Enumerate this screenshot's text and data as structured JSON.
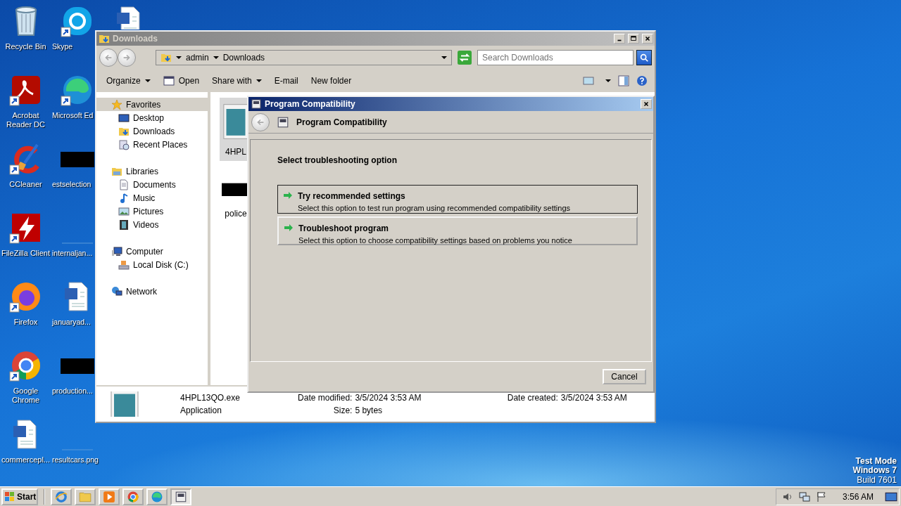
{
  "desktop": {
    "icons": [
      {
        "label": "Recycle Bin",
        "kind": "trash",
        "shortcut": false
      },
      {
        "label": "Acrobat Reader DC",
        "kind": "pdf",
        "shortcut": true
      },
      {
        "label": "CCleaner",
        "kind": "brush",
        "shortcut": true
      },
      {
        "label": "FileZilla Client",
        "kind": "bolt",
        "shortcut": true
      },
      {
        "label": "Firefox",
        "kind": "firefox",
        "shortcut": true
      },
      {
        "label": "Google Chrome",
        "kind": "chrome",
        "shortcut": true
      },
      {
        "label": "commercepl...",
        "kind": "word",
        "shortcut": false
      },
      {
        "label": "Skype",
        "kind": "skype",
        "shortcut": true
      },
      {
        "label": "Microsoft Ed",
        "kind": "edge",
        "shortcut": true
      },
      {
        "label": "estselection",
        "kind": "black",
        "shortcut": false
      },
      {
        "label": "internaljan...",
        "kind": "blank",
        "shortcut": false
      },
      {
        "label": "januaryad...",
        "kind": "word",
        "shortcut": false
      },
      {
        "label": "production...",
        "kind": "black",
        "shortcut": false
      },
      {
        "label": "resultcars.png",
        "kind": "blank",
        "shortcut": false
      },
      {
        "kind": "word",
        "shortcut": false
      }
    ],
    "system_notice": [
      {
        "text": "Test Mode",
        "bold": true
      },
      {
        "text": "Windows 7",
        "bold": true
      },
      {
        "text": "Build 7601",
        "bold": false
      }
    ]
  },
  "explorer": {
    "title": "Downloads",
    "breadcrumb": [
      "admin",
      "Downloads"
    ],
    "search": {
      "placeholder": "Search Downloads"
    },
    "toolbar": [
      {
        "label": "Organize",
        "menu": true
      },
      {
        "label": "Open",
        "kind": "open",
        "menu": false
      },
      {
        "label": "Share with",
        "menu": true
      },
      {
        "label": "E-mail",
        "menu": false
      },
      {
        "label": "New folder",
        "menu": false
      }
    ],
    "toolbar_right": [
      {
        "kind": "views",
        "menu": true
      },
      {
        "kind": "pane",
        "menu": false
      },
      {
        "kind": "help",
        "menu": false
      }
    ],
    "nav": [
      {
        "label": "Favorites",
        "kind": "star",
        "selected": true,
        "children": [
          {
            "label": "Desktop",
            "kind": "desktop",
            "selected": false
          },
          {
            "label": "Downloads",
            "kind": "dlfolder",
            "selected": false
          },
          {
            "label": "Recent Places",
            "kind": "recent",
            "selected": false
          }
        ]
      },
      {
        "label": "Libraries",
        "kind": "libraries",
        "selected": false,
        "children": [
          {
            "label": "Documents",
            "kind": "document",
            "selected": false
          },
          {
            "label": "Music",
            "kind": "music",
            "selected": false
          },
          {
            "label": "Pictures",
            "kind": "pictures",
            "selected": false
          },
          {
            "label": "Videos",
            "kind": "videos",
            "selected": false
          }
        ]
      },
      {
        "label": "Computer",
        "kind": "computer",
        "selected": false,
        "children": [
          {
            "label": "Local Disk (C:)",
            "kind": "disk",
            "selected": false
          }
        ]
      },
      {
        "label": "Network",
        "kind": "network",
        "selected": false
      }
    ],
    "files": [
      {
        "label": "4HPL",
        "kind": "app",
        "selected": true
      },
      {
        "label": "police",
        "kind": "black",
        "selected": false
      }
    ],
    "details": {
      "name": "4HPL13QO.exe",
      "type": "Application",
      "fields": [
        {
          "label": "Date modified:",
          "value": "3/5/2024 3:53 AM"
        },
        {
          "label": "Date created:",
          "value": "3/5/2024 3:53 AM"
        },
        {
          "label": "Size:",
          "value": "5 bytes"
        }
      ]
    }
  },
  "dialog": {
    "title": "Program Compatibility",
    "header": "Program Compatibility",
    "heading": "Select troubleshooting option",
    "options": [
      {
        "title": "Try recommended settings",
        "description": "Select this option to test run program using recommended compatibility settings",
        "selected": true
      },
      {
        "title": "Troubleshoot program",
        "description": "Select this option to choose compatibility settings based on problems you notice",
        "selected": false
      }
    ],
    "cancel": "Cancel"
  },
  "taskbar": {
    "start": "Start",
    "apps": [
      {
        "kind": "ie",
        "active": false
      },
      {
        "kind": "folder",
        "active": false
      },
      {
        "kind": "media",
        "active": false
      },
      {
        "kind": "chrome",
        "active": false
      },
      {
        "kind": "edge",
        "active": false
      },
      {
        "kind": "compat",
        "active": true
      }
    ],
    "tray": [
      {
        "kind": "speaker"
      },
      {
        "kind": "netmon"
      },
      {
        "kind": "flag"
      }
    ],
    "clock": "3:56 AM"
  }
}
